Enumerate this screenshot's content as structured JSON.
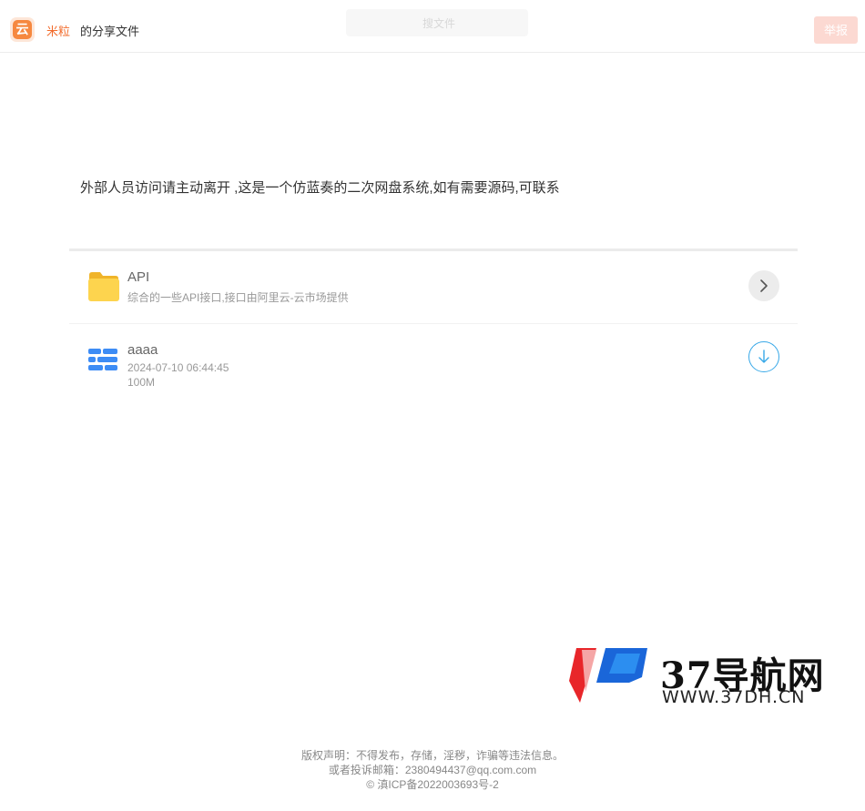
{
  "header": {
    "logo_glyph": "云",
    "owner_name": "米粒",
    "share_suffix": "的分享文件",
    "search_placeholder": "搜文件",
    "report_label": "举报"
  },
  "notice": "外部人员访问请主动离开 ,这是一个仿蓝奏的二次网盘系统,如有需要源码,可联系",
  "files": [
    {
      "name": "API",
      "description": "综合的一些API接口,接口由阿里云-云市场提供",
      "icon": "folder-icon",
      "action_icon": "chevron-right-icon"
    },
    {
      "name": "aaaa",
      "date": "2024-07-10 06:44:45",
      "size": "100M",
      "icon": "database-icon",
      "action_icon": "download-icon"
    }
  ],
  "watermark": {
    "title": "37导航网",
    "url": "WWW.37DH.CN"
  },
  "footer": {
    "line1": "版权声明：不得发布，存储，淫秽，诈骗等违法信息。",
    "line2": "或者投诉邮箱：2380494437@qq.com.com",
    "line3": "© 滇ICP备2022003693号-2"
  },
  "colors": {
    "accent": "#f26b2b",
    "report_button": "#fcd9d2",
    "download_ring": "#39a9e8",
    "folder": "#fdd44e"
  }
}
